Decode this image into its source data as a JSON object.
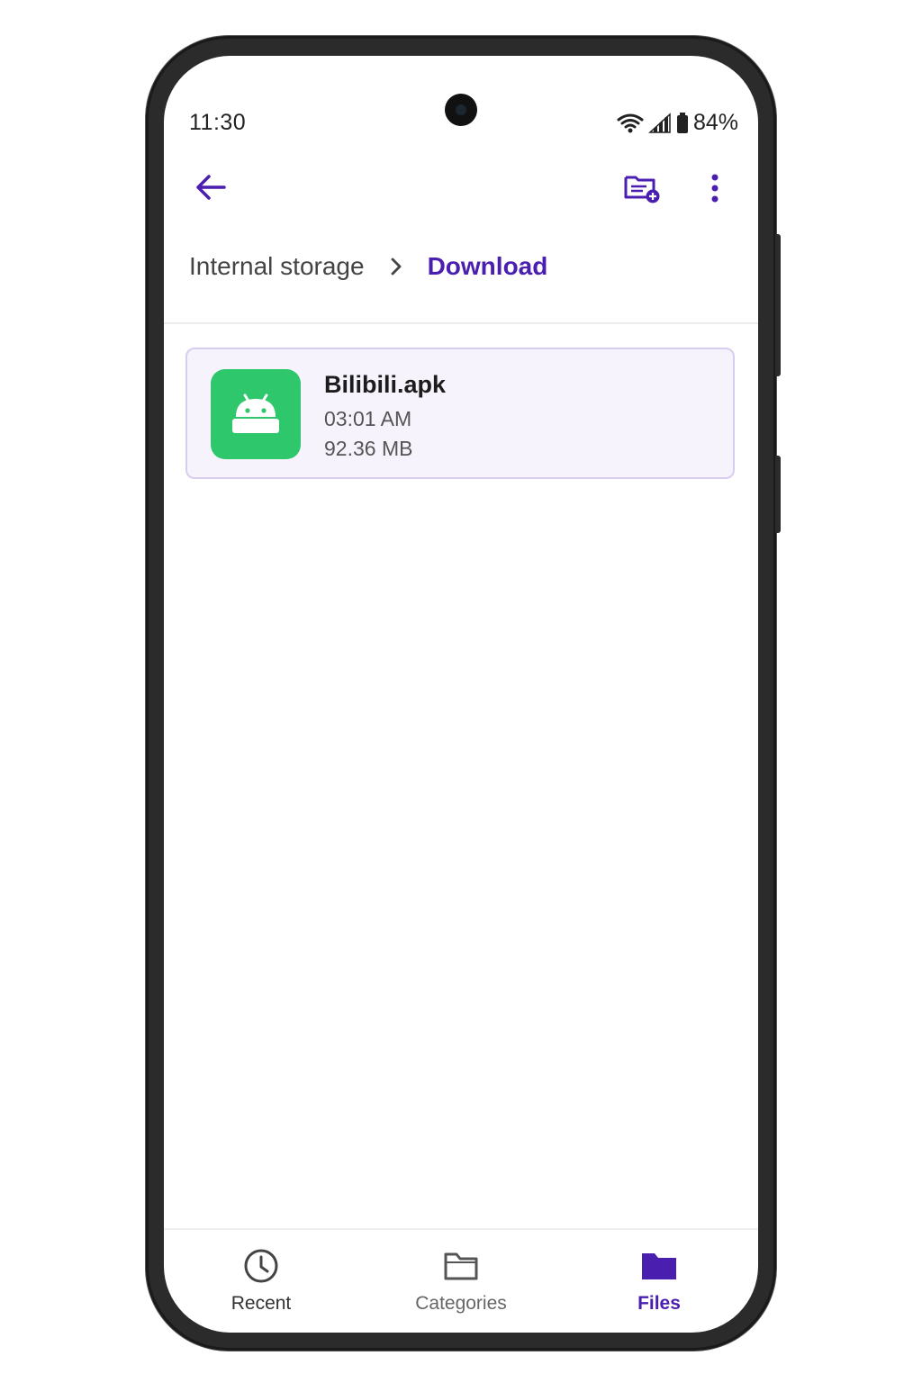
{
  "status_bar": {
    "time": "11:30",
    "battery_percent": "84%",
    "icons": [
      "wifi-icon",
      "signal-icon",
      "battery-icon"
    ]
  },
  "toolbar": {
    "back_icon": "arrow-back-icon",
    "new_folder_icon": "create-folder-icon",
    "more_icon": "more-vert-icon"
  },
  "breadcrumb": {
    "root": "Internal storage",
    "current": "Download"
  },
  "files": [
    {
      "name": "Bilibili.apk",
      "time": "03:01 AM",
      "size": "92.36 MB",
      "icon": "android-icon",
      "selected": true
    }
  ],
  "bottom_nav": {
    "items": [
      {
        "label": "Recent",
        "icon": "clock-icon",
        "active": false
      },
      {
        "label": "Categories",
        "icon": "folder-outline-icon",
        "active": false
      },
      {
        "label": "Files",
        "icon": "folder-filled-icon",
        "active": true
      }
    ]
  },
  "colors": {
    "accent": "#4a1fb0",
    "apk_green": "#2ec76c",
    "selected_bg": "#f7f3fc",
    "selected_border": "#d9cdef"
  }
}
